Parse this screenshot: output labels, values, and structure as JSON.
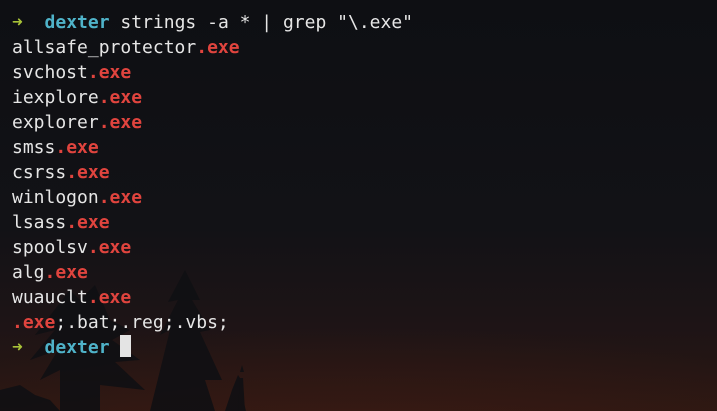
{
  "prompt": {
    "arrow": "➜",
    "dir": "dexter"
  },
  "command": "strings -a * | grep \"\\.exe\"",
  "results": [
    {
      "prefix": "allsafe_protector",
      "match": ".exe",
      "suffix": ""
    },
    {
      "prefix": "svchost",
      "match": ".exe",
      "suffix": ""
    },
    {
      "prefix": "iexplore",
      "match": ".exe",
      "suffix": ""
    },
    {
      "prefix": "explorer",
      "match": ".exe",
      "suffix": ""
    },
    {
      "prefix": "smss",
      "match": ".exe",
      "suffix": ""
    },
    {
      "prefix": "csrss",
      "match": ".exe",
      "suffix": ""
    },
    {
      "prefix": "winlogon",
      "match": ".exe",
      "suffix": ""
    },
    {
      "prefix": "lsass",
      "match": ".exe",
      "suffix": ""
    },
    {
      "prefix": "spoolsv",
      "match": ".exe",
      "suffix": ""
    },
    {
      "prefix": "alg",
      "match": ".exe",
      "suffix": ""
    },
    {
      "prefix": "wuauclt",
      "match": ".exe",
      "suffix": ""
    },
    {
      "prefix": "",
      "match": ".exe",
      "suffix": ";.bat;.reg;.vbs;"
    }
  ],
  "colors": {
    "prompt_arrow": "#a8c238",
    "prompt_dir": "#4fb3c9",
    "match": "#e0443e",
    "text": "#e6e6e6",
    "cursor": "#e4e4e4"
  }
}
